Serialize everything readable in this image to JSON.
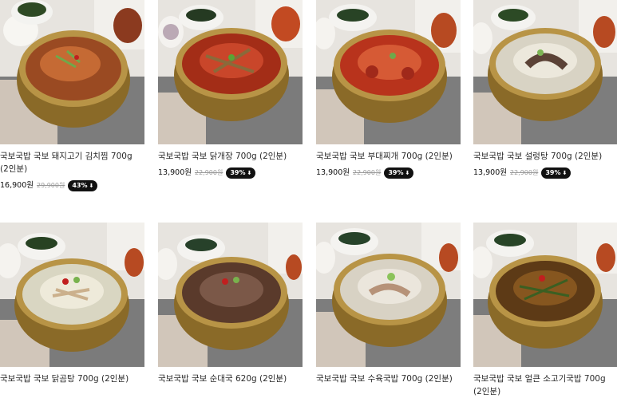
{
  "products": [
    {
      "title": "국보국밥 국보 돼지고기 김치찜 700g (2인분)",
      "price": "16,900원",
      "original": "29,900원",
      "discount": "43%",
      "soup": "#9a4a22",
      "soup2": "#c56a34"
    },
    {
      "title": "국보국밥 국보 닭개장 700g (2인분)",
      "price": "13,900원",
      "original": "22,900원",
      "discount": "39%",
      "soup": "#a32d17",
      "soup2": "#c9462a"
    },
    {
      "title": "국보국밥 국보 부대찌개 700g (2인분)",
      "price": "13,900원",
      "original": "22,900원",
      "discount": "39%",
      "soup": "#b8331c",
      "soup2": "#d65a35"
    },
    {
      "title": "국보국밥 국보 설렁탕 700g (2인분)",
      "price": "13,900원",
      "original": "22,900원",
      "discount": "39%",
      "soup": "#d8d3c4",
      "soup2": "#ece8dc"
    },
    {
      "title": "국보국밥 국보 닭곰탕 700g (2인분)",
      "soup": "#d9d6c2",
      "soup2": "#eeeada"
    },
    {
      "title": "국보국밥 국보 순대국 620g (2인분)",
      "soup": "#5a3a2b",
      "soup2": "#7b5848"
    },
    {
      "title": "국보국밥 국보 수육국밥 700g (2인분)",
      "soup": "#d8d2c4",
      "soup2": "#ebe6dc"
    },
    {
      "title": "국보국밥 국보 얼큰 소고기국밥 700g (2인분)",
      "soup": "#5d3a16",
      "soup2": "#86561f"
    }
  ]
}
